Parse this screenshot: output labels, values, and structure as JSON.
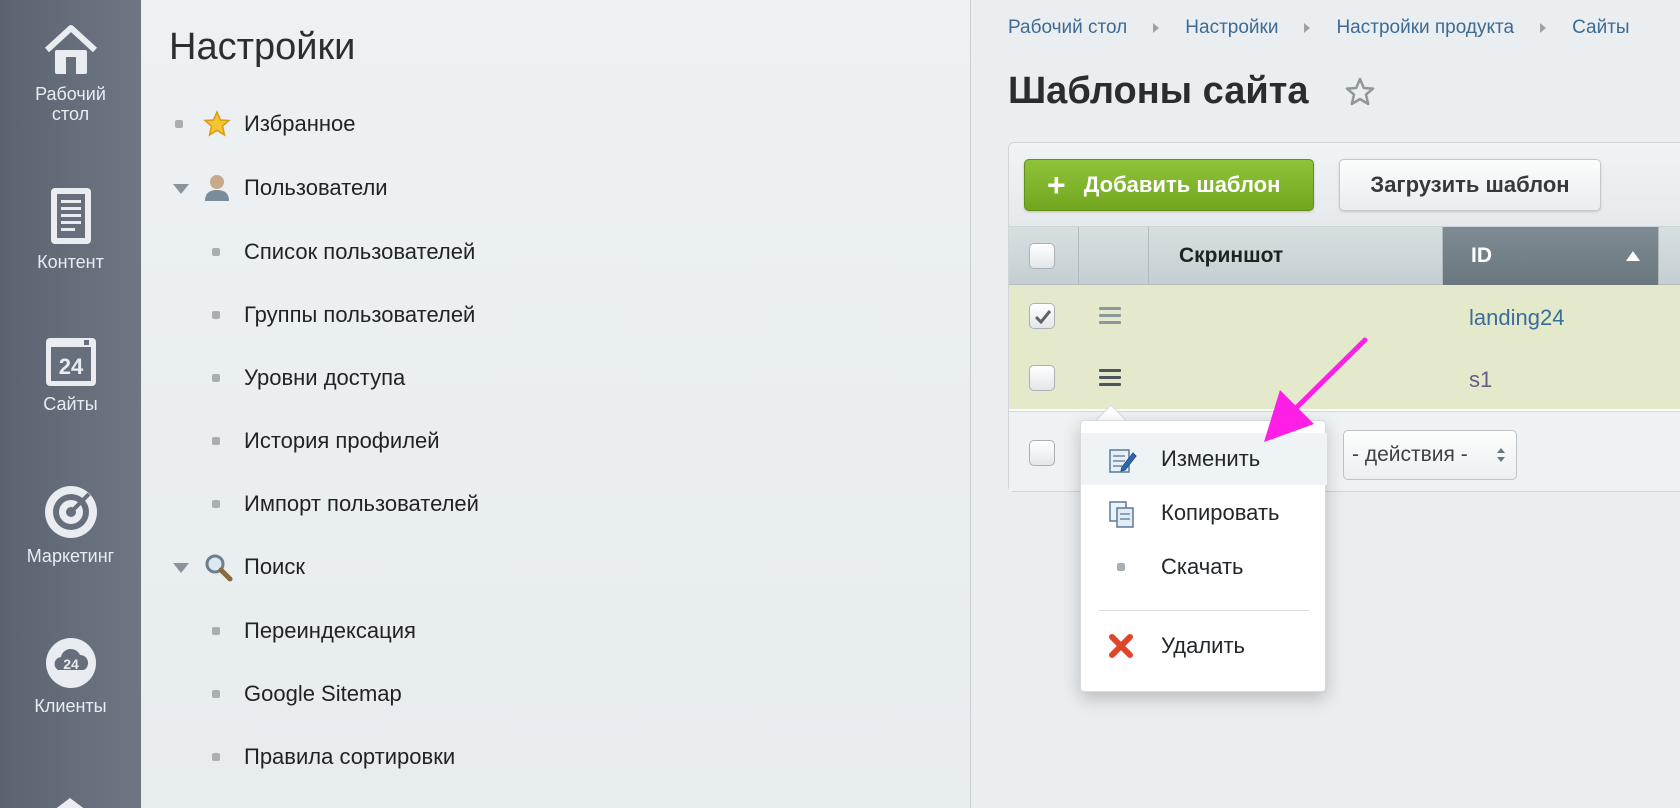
{
  "iconbar": {
    "items": [
      {
        "label": "Рабочий стол",
        "icon": "home-icon"
      },
      {
        "label": "Контент",
        "icon": "document-icon"
      },
      {
        "label": "Сайты",
        "icon": "calendar-24-icon"
      },
      {
        "label": "Маркетинг",
        "icon": "target-icon"
      },
      {
        "label": "Клиенты",
        "icon": "cloud-24-icon"
      }
    ]
  },
  "menu": {
    "title": "Настройки",
    "items": [
      {
        "label": "Избранное",
        "type": "top",
        "icon": "star-icon"
      },
      {
        "label": "Пользователи",
        "type": "group",
        "icon": "user-icon"
      },
      {
        "label": "Список пользователей",
        "type": "sub"
      },
      {
        "label": "Группы пользователей",
        "type": "sub"
      },
      {
        "label": "Уровни доступа",
        "type": "sub"
      },
      {
        "label": "История профилей",
        "type": "sub"
      },
      {
        "label": "Импорт пользователей",
        "type": "sub"
      },
      {
        "label": "Поиск",
        "type": "group",
        "icon": "magnifier-icon"
      },
      {
        "label": "Переиндексация",
        "type": "sub"
      },
      {
        "label": "Google Sitemap",
        "type": "sub"
      },
      {
        "label": "Правила сортировки",
        "type": "sub"
      }
    ]
  },
  "breadcrumbs": [
    "Рабочий стол",
    "Настройки",
    "Настройки продукта",
    "Сайты"
  ],
  "page": {
    "title": "Шаблоны сайта"
  },
  "toolbar": {
    "add_label": "Добавить шаблон",
    "upload_label": "Загрузить шаблон"
  },
  "table": {
    "columns": [
      "Скриншот",
      "ID"
    ],
    "rows": [
      {
        "id": "landing24",
        "checked": true
      },
      {
        "id": "s1",
        "checked": false
      }
    ],
    "actions_select": "- действия -"
  },
  "context_menu": {
    "items": [
      {
        "label": "Изменить",
        "icon": "edit-icon"
      },
      {
        "label": "Копировать",
        "icon": "copy-icon"
      },
      {
        "label": "Скачать",
        "icon": "bullet-icon"
      },
      {
        "label": "Удалить",
        "icon": "delete-x-icon"
      }
    ]
  },
  "colors": {
    "iconbar_bg": "#676f7c",
    "add_button": "#7fb42b",
    "row_highlight": "#e4e9cc",
    "link": "#3a6d98",
    "annotation_arrow": "#ff1ee6"
  }
}
